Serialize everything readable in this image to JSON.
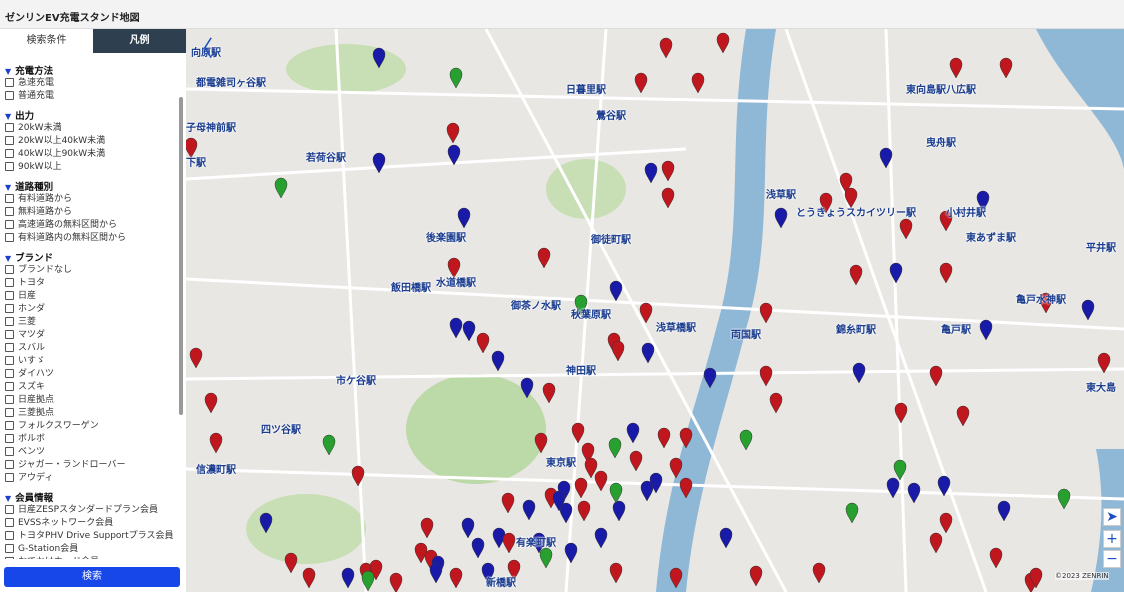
{
  "app": {
    "title": "ゼンリンEV充電スタンド地図"
  },
  "tabs": [
    {
      "label": "検索条件"
    },
    {
      "label": "凡例"
    }
  ],
  "sections": [
    {
      "title": "充電方法",
      "items": [
        "急速充電",
        "普通充電"
      ]
    },
    {
      "title": "出力",
      "items": [
        "20kW未満",
        "20kW以上40kW未満",
        "40kW以上90kW未満",
        "90kW以上"
      ]
    },
    {
      "title": "道路種別",
      "items": [
        "有料道路から",
        "無料道路から",
        "高速道路の無料区間から",
        "有料道路内の無料区間から"
      ]
    },
    {
      "title": "ブランド",
      "items": [
        "ブランドなし",
        "トヨタ",
        "日産",
        "ホンダ",
        "三菱",
        "マツダ",
        "スバル",
        "いすゞ",
        "ダイハツ",
        "スズキ",
        "日産拠点",
        "三菱拠点",
        "フォルクスワーゲン",
        "ボルボ",
        "ベンツ",
        "ジャガー・ランドローバー",
        "アウディ"
      ]
    },
    {
      "title": "会員情報",
      "items": [
        "日産ZESPスタンダードプラン会員",
        "EVSSネットワーク会員",
        "トヨタPHV Drive Supportプラス会員",
        "G-Station会員",
        "おでかけカード会員"
      ]
    }
  ],
  "search_button": "検索",
  "map": {
    "stations": [
      "向原駅",
      "日暮里駅",
      "八広駅",
      "都電雑司ヶ谷駅",
      "東向島駅",
      "子母神前駅",
      "若荷谷駅",
      "鶯谷駅",
      "曳舟駅",
      "下駅",
      "浅草駅",
      "とうきょうスカイツリー駅",
      "小村井駅",
      "後楽園駅",
      "東あずま駅",
      "御徒町駅",
      "平井駅",
      "水道橋駅",
      "飯田橋駅",
      "御茶ノ水駅",
      "秋葉原駅",
      "浅草橋駅",
      "両国駅",
      "錦糸町駅",
      "亀戸駅",
      "亀戸水神駅",
      "市ケ谷駅",
      "神田駅",
      "東大島",
      "四ツ谷駅",
      "東京駅",
      "有楽町駅",
      "新橋駅",
      "信濃町駅"
    ],
    "copyright": "©2023 ZENRIN"
  },
  "controls": {
    "collapse": "〈",
    "locate": "➤",
    "zoom_in": "+",
    "zoom_out": "−"
  },
  "colors": {
    "accent": "#1747e8",
    "tab_dark": "#2e3f4f",
    "marker_red": "#c0161e",
    "marker_blue": "#1a1aa8",
    "marker_green": "#28a030"
  }
}
